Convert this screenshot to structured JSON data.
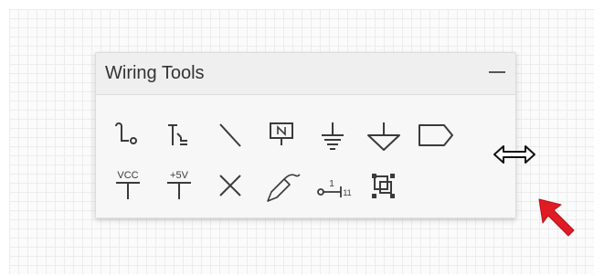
{
  "panel": {
    "title": "Wiring Tools"
  },
  "tools": [
    {
      "name": "wire-tool"
    },
    {
      "name": "bus-tool"
    },
    {
      "name": "bus-entry-tool"
    },
    {
      "name": "net-label-tool"
    },
    {
      "name": "ground-tool"
    },
    {
      "name": "power-port-tool"
    },
    {
      "name": "port-tool"
    },
    {
      "name": "vcc-power-tool",
      "label": "VCC"
    },
    {
      "name": "plus5v-power-tool",
      "label": "+5V"
    },
    {
      "name": "no-erc-tool"
    },
    {
      "name": "signal-harness-tool"
    },
    {
      "name": "sheet-entry-tool",
      "label_top": "1",
      "label_right": "11"
    },
    {
      "name": "sheet-symbol-tool"
    }
  ],
  "colors": {
    "icon": "#3a3a3a",
    "pointer": "#e01b24",
    "panel_bg": "#f7f7f7",
    "header_bg": "#efefef"
  }
}
